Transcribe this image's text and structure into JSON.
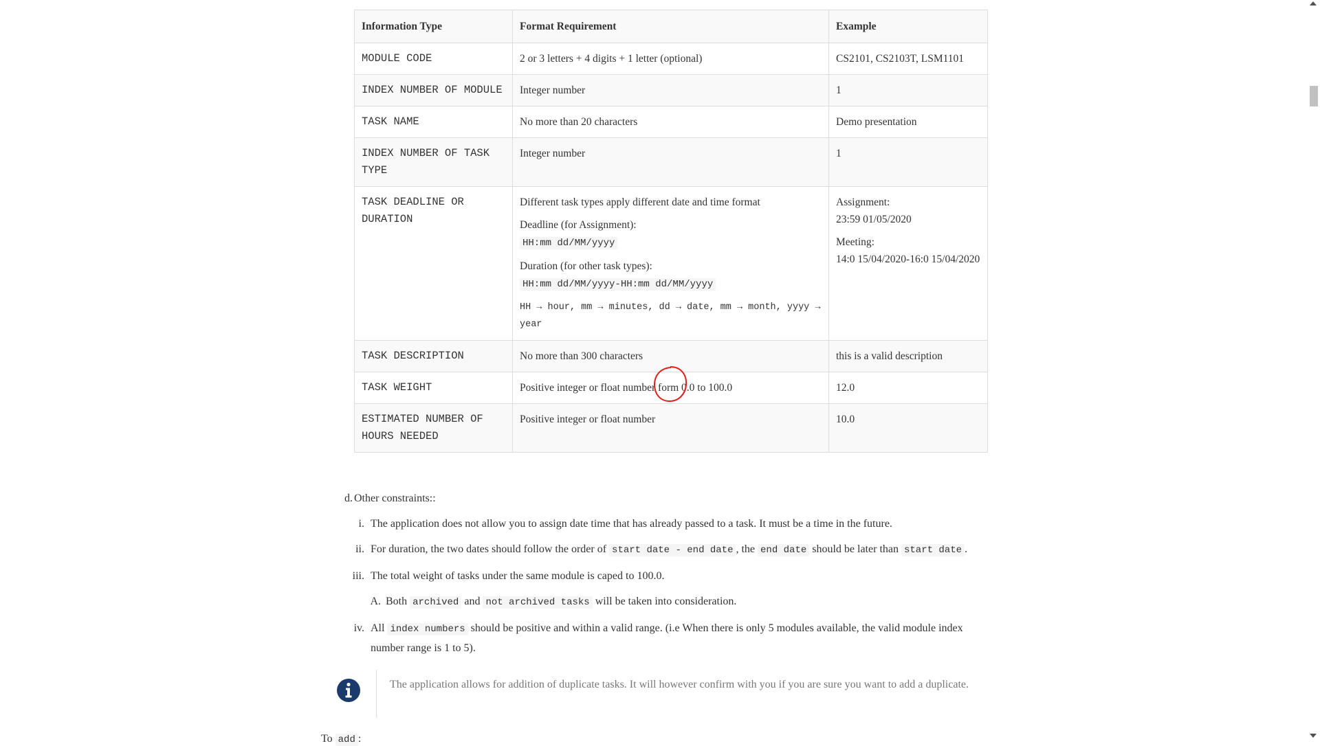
{
  "table": {
    "headers": [
      "Information Type",
      "Format Requirement",
      "Example"
    ],
    "rows": [
      {
        "type": "MODULE CODE",
        "format": "2 or 3 letters + 4 digits + 1 letter (optional)",
        "example": "CS2101, CS2103T, LSM1101"
      },
      {
        "type": "INDEX NUMBER OF MODULE",
        "format": "Integer number",
        "example": "1"
      },
      {
        "type": "TASK NAME",
        "format": "No more than 20 characters",
        "example": "Demo presentation"
      },
      {
        "type": "INDEX NUMBER OF TASK TYPE",
        "format": "Integer number",
        "example": "1"
      },
      {
        "type": "TASK DEADLINE OR DURATION",
        "format_intro": "Different task types apply different date and time format",
        "deadline_label": "Deadline (for Assignment):",
        "deadline_format": "HH:mm dd/MM/yyyy",
        "duration_label": "Duration (for other task types):",
        "duration_format": "HH:mm dd/MM/yyyy-HH:mm dd/MM/yyyy",
        "legend": "HH → hour, mm → minutes, dd → date, mm → month, yyyy → year",
        "example_assignment_label": "Assignment:",
        "example_assignment_value": "23:59 01/05/2020",
        "example_meeting_label": "Meeting:",
        "example_meeting_value": "14:0 15/04/2020-16:0 15/04/2020"
      },
      {
        "type": "TASK DESCRIPTION",
        "format": "No more than 300 characters",
        "example": "this is a valid description"
      },
      {
        "type": "TASK WEIGHT",
        "format_before": "Positive integer or float number ",
        "format_marked": "form",
        "format_after": " 0.0 to 100.0",
        "example": "12.0"
      },
      {
        "type": "ESTIMATED NUMBER OF HOURS NEEDED",
        "format": "Positive integer or float number",
        "example": "10.0"
      }
    ]
  },
  "constraints": {
    "marker": "d.",
    "heading": "Other constraints::",
    "items": [
      {
        "marker": "i.",
        "text": "The application does not allow you to assign date time that has already passed to a task. It must be a time in the future."
      },
      {
        "marker": "ii.",
        "t1": "For duration, the two dates should follow the order of ",
        "c1": "start date - end date",
        "t2": ", the ",
        "c2": "end date",
        "t3": " should be later than ",
        "c3": "start date",
        "t4": "."
      },
      {
        "marker": "iii.",
        "text": "The total weight of tasks under the same module is caped to 100.0."
      },
      {
        "marker": "A.",
        "t1": "Both ",
        "c1": "archived",
        "t2": " and ",
        "c2": "not archived tasks",
        "t3": " will be taken into consideration."
      },
      {
        "marker": "iv.",
        "t1": "All ",
        "c1": "index numbers",
        "t2": " should be positive and within a valid range. (i.e When there is only 5 modules available, the valid module index number range is 1 to 5)."
      }
    ]
  },
  "note": {
    "icon": "info-icon",
    "text": "The application allows for addition of duplicate tasks. It will however confirm with you if you are sure you want to add a duplicate."
  },
  "tail": {
    "text": "To ",
    "code": "add",
    "after": ":"
  },
  "colors": {
    "annotation": "#e0201c",
    "info_icon": "#1a3a6b",
    "code_bg": "#f5f5f5"
  }
}
